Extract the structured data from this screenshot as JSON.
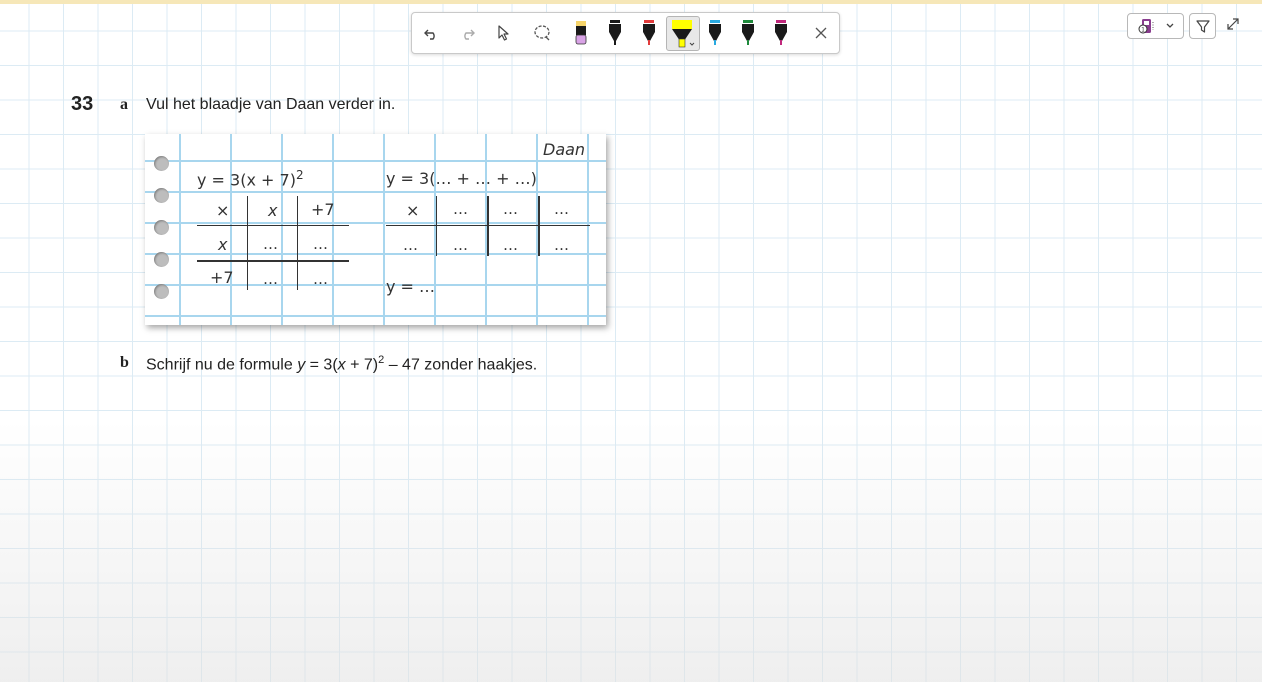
{
  "toolbar": {
    "tools": [
      "undo-icon",
      "redo-icon",
      "select-pointer-icon",
      "lasso-icon",
      "highlighter-pink-icon",
      "pen-black-icon",
      "pen-red-icon",
      "highlighter-yellow-icon",
      "pen-blue-icon",
      "pen-green-icon",
      "pen-purple-icon",
      "close-icon"
    ],
    "colors": {
      "pink": "#d9a3e6",
      "black": "#1a1a1a",
      "red": "#e23b3b",
      "yellow": "#ffff00",
      "blue": "#29a9e0",
      "green": "#1f8a3c",
      "purple": "#c0287c"
    }
  },
  "exercise": {
    "number": "33",
    "a": {
      "letter": "a",
      "text": "Vul het blaadje van Daan verder in."
    },
    "b": {
      "letter": "b",
      "text_before": "Schrijf nu de formule ",
      "var_y": "y",
      "eq_part1": " = 3(",
      "var_x": "x",
      "eq_part2": " + 7)",
      "exponent": "2",
      "eq_part3": " – 47 zonder haakjes."
    }
  },
  "sheet": {
    "name": "Daan",
    "formula_left": "y = 3(x + 7)",
    "formula_left_exp": "2",
    "formula_right": "y = 3(… + … + …)",
    "left_table": {
      "header": [
        "×",
        "x",
        "+7"
      ],
      "rows": [
        [
          "x",
          "…",
          "…"
        ],
        [
          "+7",
          "…",
          "…"
        ]
      ]
    },
    "right_table": {
      "header": [
        "×",
        "…",
        "…",
        "…"
      ],
      "row": [
        "…",
        "…",
        "…",
        "…"
      ]
    },
    "result": "y = …"
  }
}
